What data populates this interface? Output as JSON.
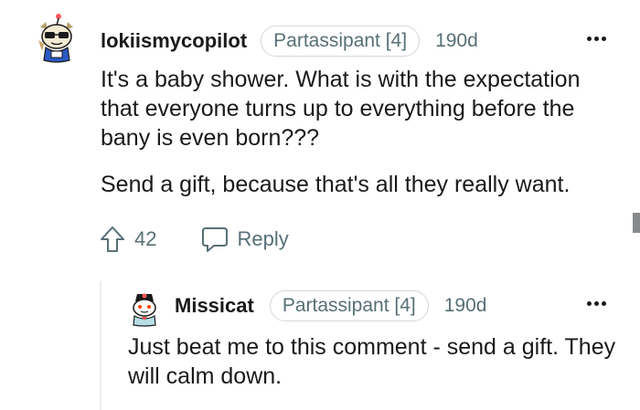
{
  "comments": [
    {
      "username": "lokiismycopilot",
      "flair": "Partassipant [4]",
      "age": "190d",
      "paragraphs": [
        "It's a baby shower. What is with the expectation that everyone turns up to everything before the bany is even born???",
        "Send a gift, because that's all they really want."
      ],
      "votes": "42",
      "reply_label": "Reply"
    },
    {
      "username": "Missicat",
      "flair": "Partassipant [4]",
      "age": "190d",
      "paragraphs": [
        "Just beat me to this comment - send a gift. They will calm down."
      ]
    }
  ],
  "icons": {
    "avatar_top": "snoo-sunglasses-avatar",
    "avatar_reply": "snoo-hat-avatar",
    "overflow": "more-horizontal-icon",
    "upvote": "upvote-arrow-icon",
    "reply": "speech-bubble-icon"
  },
  "colors": {
    "text": "#1a1a1b",
    "meta": "#576f76",
    "flair_border": "#d4d7d9",
    "thread_line": "#edeff1"
  }
}
